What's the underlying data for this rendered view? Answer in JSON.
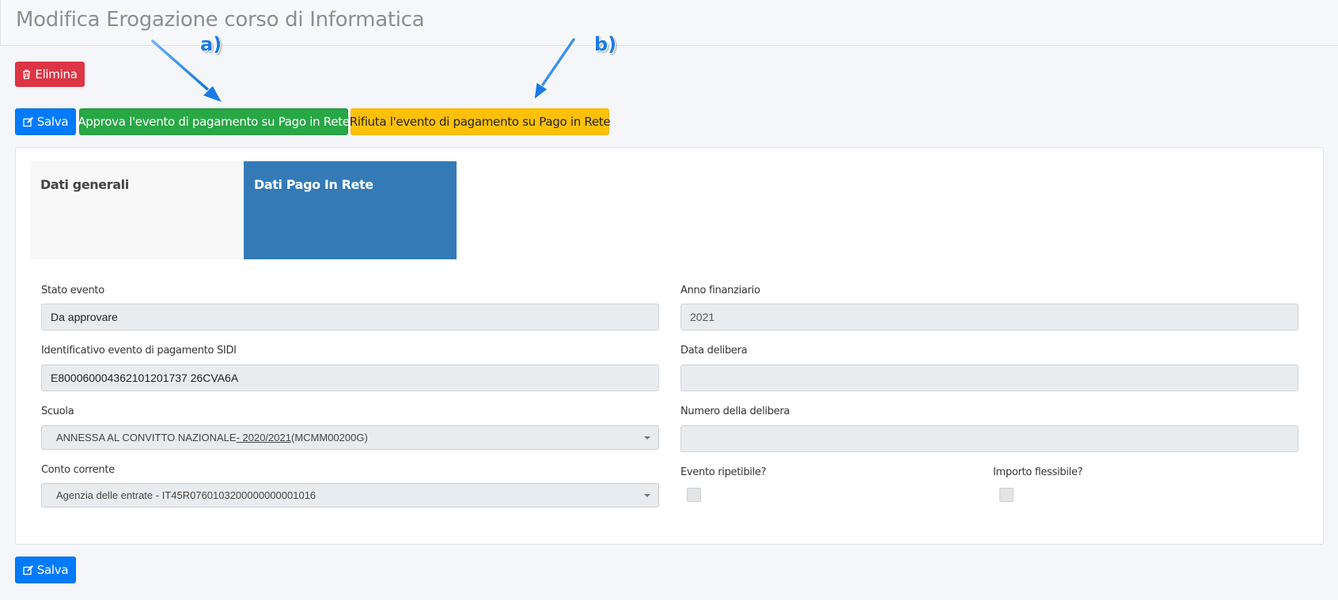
{
  "header": {
    "title": "Modifica Erogazione corso di Informatica"
  },
  "annotations": {
    "a": "a)",
    "b": "b)"
  },
  "toolbar": {
    "delete_label": "Elimina",
    "save_label": "Salva",
    "approve_label": "Approva l'evento di pagamento su Pago in Rete",
    "reject_label": "Rifiuta l'evento di pagamento su Pago in Rete"
  },
  "tabs": [
    {
      "label": "Dati generali",
      "active": false
    },
    {
      "label": "Dati Pago In Rete",
      "active": true
    }
  ],
  "form": {
    "stato_evento": {
      "label": "Stato evento",
      "value": "Da approvare"
    },
    "id_evento": {
      "label": "Identificativo evento di pagamento SIDI",
      "value": "E800060004362101201737 26CVA6A"
    },
    "scuola": {
      "label": "Scuola",
      "value_part1": "ANNESSA AL CONVITTO NAZIONALE",
      "value_part2": " - 2020/2021 ",
      "value_part3": "(MCMM00200G)"
    },
    "conto_corrente": {
      "label": "Conto corrente",
      "value": "Agenzia delle entrate - IT45R0760103200000000001016"
    },
    "anno_finanziario": {
      "label": "Anno finanziario",
      "value": "2021"
    },
    "data_delibera": {
      "label": "Data delibera",
      "value": ""
    },
    "numero_delibera": {
      "label": "Numero della delibera",
      "value": ""
    },
    "evento_ripetibile": {
      "label": "Evento ripetibile?",
      "checked": false
    },
    "importo_flessibile": {
      "label": "Importo flessibile?",
      "checked": false
    }
  },
  "footer": {
    "save_label": "Salva"
  },
  "colors": {
    "danger": "#dc3545",
    "primary": "#007bff",
    "success": "#28a745",
    "warning": "#ffc107",
    "tab_active": "#337ab7",
    "annotation": "#1a7ae8"
  }
}
